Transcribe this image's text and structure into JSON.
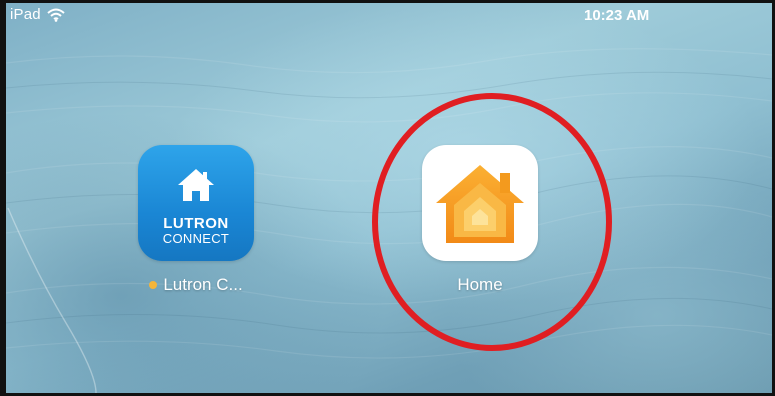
{
  "status_bar": {
    "device": "iPad",
    "time": "10:23 AM",
    "wifi_icon": "wifi-icon"
  },
  "apps": [
    {
      "id": "lutron",
      "label": "Lutron C...",
      "icon": "lutron-connect-app-icon",
      "icon_text_main": "LUTRON",
      "icon_text_sub": "CONNECT",
      "has_update_dot": true,
      "icon_color": "#1a86d4"
    },
    {
      "id": "home",
      "label": "Home",
      "icon": "home-app-icon",
      "icon_color": "#f39a1e"
    }
  ],
  "annotation": {
    "shape": "circle",
    "color": "#e01e22",
    "target": "Home"
  }
}
